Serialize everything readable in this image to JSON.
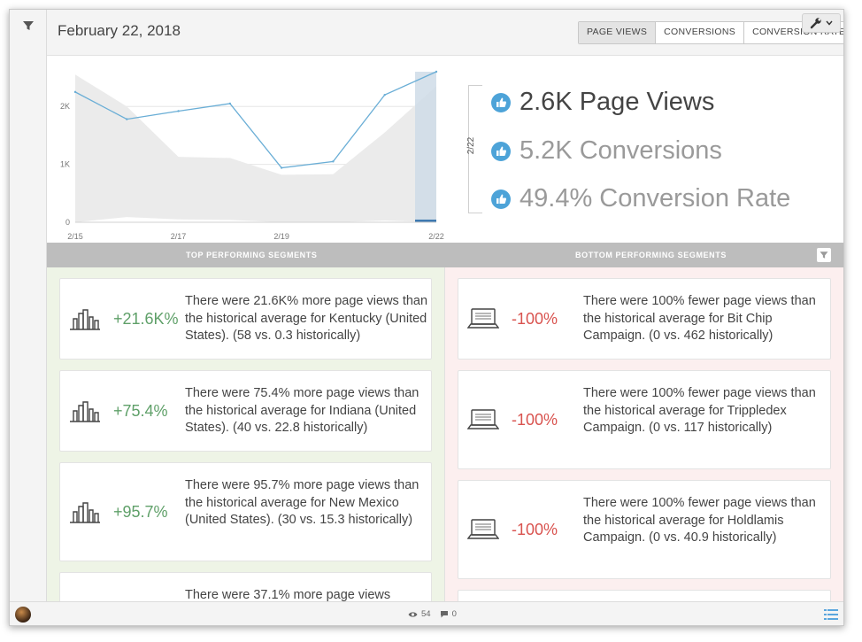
{
  "header": {
    "date_title": "February 22, 2018",
    "tabs": [
      {
        "label": "PAGE VIEWS",
        "active": true
      },
      {
        "label": "CONVERSIONS",
        "active": false
      },
      {
        "label": "CONVERSION RATE",
        "active": false
      }
    ]
  },
  "chart_data": {
    "type": "line",
    "x": [
      "2/15",
      "2/16",
      "2/17",
      "2/18",
      "2/19",
      "2/20",
      "2/21",
      "2/22"
    ],
    "xtick_labels": [
      "2/15",
      "2/17",
      "2/19",
      "2/22"
    ],
    "ytick_labels": [
      "0",
      "1K",
      "2K"
    ],
    "ylim": [
      0,
      2600
    ],
    "series": [
      {
        "values": [
          2250,
          1780,
          1920,
          2050,
          940,
          1050,
          2200,
          2600
        ]
      }
    ],
    "band_upper": [
      2550,
      2000,
      1130,
      1110,
      820,
      830,
      1550,
      2350
    ],
    "band_lower": [
      0,
      90,
      50,
      40,
      0,
      0,
      30,
      0
    ],
    "highlight": "2/22",
    "grid": true
  },
  "summary": {
    "date_label": "2/22",
    "metrics": [
      {
        "value": "2.6K Page Views"
      },
      {
        "value": "5.2K Conversions"
      },
      {
        "value": "49.4% Conversion Rate"
      }
    ]
  },
  "segments": {
    "top_label": "TOP PERFORMING SEGMENTS",
    "bottom_label": "BOTTOM PERFORMING SEGMENTS",
    "top": [
      {
        "pct": "+21.6K%",
        "text": "There were 21.6K% more page views than the historical average for Kentucky (United States). (58 vs. 0.3 historically)",
        "icon": "city-icon"
      },
      {
        "pct": "+75.4%",
        "text": "There were 75.4% more page views than the historical average for Indiana (United States). (40 vs. 22.8 historically)",
        "icon": "city-icon"
      },
      {
        "pct": "+95.7%",
        "text": "There were 95.7% more page views than the historical average for New Mexico (United States). (30 vs. 15.3 historically)",
        "icon": "city-icon"
      },
      {
        "pct": "",
        "text": "There were 37.1% more page views",
        "icon": "city-icon"
      }
    ],
    "bottom": [
      {
        "pct": "-100%",
        "text": "There were 100% fewer page views than the historical average for Bit Chip Campaign. (0 vs. 462 historically)",
        "icon": "laptop-icon"
      },
      {
        "pct": "-100%",
        "text": "There were 100% fewer page views than the historical average for Trippledex Campaign. (0 vs. 117 historically)",
        "icon": "laptop-icon"
      },
      {
        "pct": "-100%",
        "text": "There were 100% fewer page views than the historical average for Holdlamis Campaign. (0 vs. 40.9 historically)",
        "icon": "laptop-icon"
      }
    ]
  },
  "footer": {
    "views": "54",
    "comments": "0"
  },
  "colors": {
    "line": "#6aaed6",
    "band": "#ebebeb",
    "highlight": "#cfdce8",
    "positive": "#5fa069",
    "negative": "#d9534f",
    "thumb": "#4da3d8"
  }
}
